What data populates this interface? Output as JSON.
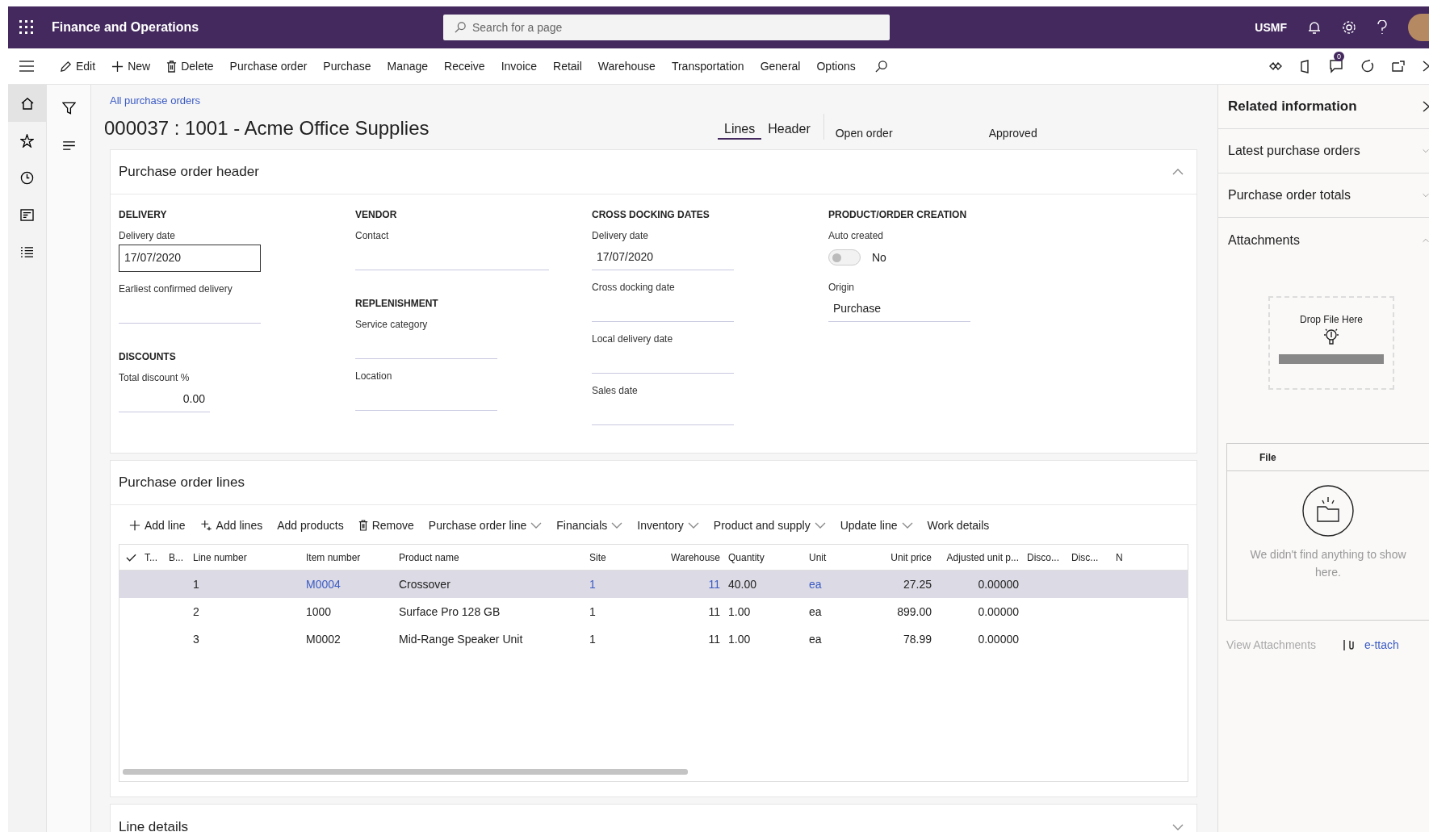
{
  "app": {
    "title": "Finance and Operations",
    "search_placeholder": "Search for a page",
    "company": "USMF"
  },
  "toolbar": {
    "items": [
      {
        "label": "Edit",
        "kind": "edit"
      },
      {
        "label": "New",
        "kind": "new"
      },
      {
        "label": "Delete",
        "kind": "delete"
      },
      {
        "label": "Purchase order",
        "kind": "plain"
      },
      {
        "label": "Purchase",
        "kind": "plain"
      },
      {
        "label": "Manage",
        "kind": "plain"
      },
      {
        "label": "Receive",
        "kind": "plain"
      },
      {
        "label": "Invoice",
        "kind": "plain"
      },
      {
        "label": "Retail",
        "kind": "plain"
      },
      {
        "label": "Warehouse",
        "kind": "plain"
      },
      {
        "label": "Transportation",
        "kind": "plain"
      },
      {
        "label": "General",
        "kind": "plain"
      },
      {
        "label": "Options",
        "kind": "plain"
      }
    ],
    "badge": "0"
  },
  "breadcrumb": "All purchase orders",
  "title": "000037 : 1001 - Acme Office Supplies",
  "tabs": [
    {
      "label": "Lines",
      "selected": true
    },
    {
      "label": "Header",
      "selected": false
    }
  ],
  "statuses": [
    "Open order",
    "Approved"
  ],
  "header_section": {
    "title": "Purchase order header",
    "expanded": true,
    "columns": [
      [
        {
          "heading": "DELIVERY",
          "fields": [
            {
              "label": "Delivery date",
              "kind": "boxed",
              "value": "17/07/2020"
            },
            {
              "label": "Earliest confirmed delivery",
              "kind": "line"
            }
          ]
        },
        {
          "heading": "DISCOUNTS",
          "fields": [
            {
              "label": "Total discount %",
              "kind": "number",
              "value": "0.00"
            }
          ]
        }
      ],
      [
        {
          "heading": "VENDOR",
          "fields": [
            {
              "label": "Contact",
              "kind": "line"
            }
          ]
        },
        {
          "heading": "REPLENISHMENT",
          "fields": [
            {
              "label": "Service category",
              "kind": "line"
            },
            {
              "label": "Location",
              "kind": "line"
            }
          ]
        }
      ],
      [
        {
          "heading": "CROSS DOCKING DATES",
          "fields": [
            {
              "label": "Delivery date",
              "kind": "line",
              "value": "17/07/2020"
            },
            {
              "label": "Cross docking date",
              "kind": "line"
            },
            {
              "label": "Local delivery date",
              "kind": "line"
            },
            {
              "label": "Sales date",
              "kind": "line"
            }
          ]
        }
      ],
      [
        {
          "heading": "PRODUCT/ORDER CREATION",
          "fields": [
            {
              "label": "Auto created",
              "kind": "toggle",
              "on": false,
              "value": "No"
            },
            {
              "label": "Origin",
              "kind": "line",
              "value": "Purchase"
            }
          ]
        }
      ]
    ]
  },
  "lines_section": {
    "title": "Purchase order lines",
    "actions": [
      {
        "label": "Add line",
        "kind": "add"
      },
      {
        "label": "Add lines",
        "kind": "add-many"
      },
      {
        "label": "Add products",
        "kind": "plain"
      },
      {
        "label": "Remove",
        "kind": "remove"
      },
      {
        "label": "Purchase order line",
        "kind": "menu"
      },
      {
        "label": "Financials",
        "kind": "menu"
      },
      {
        "label": "Inventory",
        "kind": "menu"
      },
      {
        "label": "Product and supply",
        "kind": "menu"
      },
      {
        "label": "Update line",
        "kind": "menu"
      },
      {
        "label": "Work details",
        "kind": "plain"
      }
    ],
    "columns": [
      "T...",
      "B...",
      "Line number",
      "Item number",
      "Product name",
      "Site",
      "Warehouse",
      "Quantity",
      "Unit",
      "Unit price",
      "Adjusted unit p...",
      "Disco...",
      "Disc...",
      "N"
    ],
    "rows": [
      {
        "selected": true,
        "cells": [
          "",
          "",
          "1",
          "M0004",
          "Crossover",
          "1",
          "11",
          "40.00",
          "ea",
          "27.25",
          "0.00000",
          "",
          "",
          ""
        ]
      },
      {
        "selected": false,
        "cells": [
          "",
          "",
          "2",
          "1000",
          "Surface Pro 128 GB",
          "1",
          "11",
          "1.00",
          "ea",
          "899.00",
          "0.00000",
          "",
          "",
          ""
        ]
      },
      {
        "selected": false,
        "cells": [
          "",
          "",
          "3",
          "M0002",
          "Mid-Range Speaker Unit",
          "1",
          "11",
          "1.00",
          "ea",
          "78.99",
          "0.00000",
          "",
          "",
          ""
        ]
      }
    ]
  },
  "line_details": {
    "title": "Line details",
    "expanded": false
  },
  "right_panel": {
    "title": "Related information",
    "sections": [
      {
        "title": "Latest purchase orders",
        "expanded": false
      },
      {
        "title": "Purchase order totals",
        "expanded": false
      },
      {
        "title": "Attachments",
        "expanded": true
      }
    ],
    "drop_text": "Drop File Here",
    "file_column": "File",
    "empty_message": "We didn't find anything to show here.",
    "view_attachments": "View Attachments",
    "attach_link": "e-ttach"
  }
}
